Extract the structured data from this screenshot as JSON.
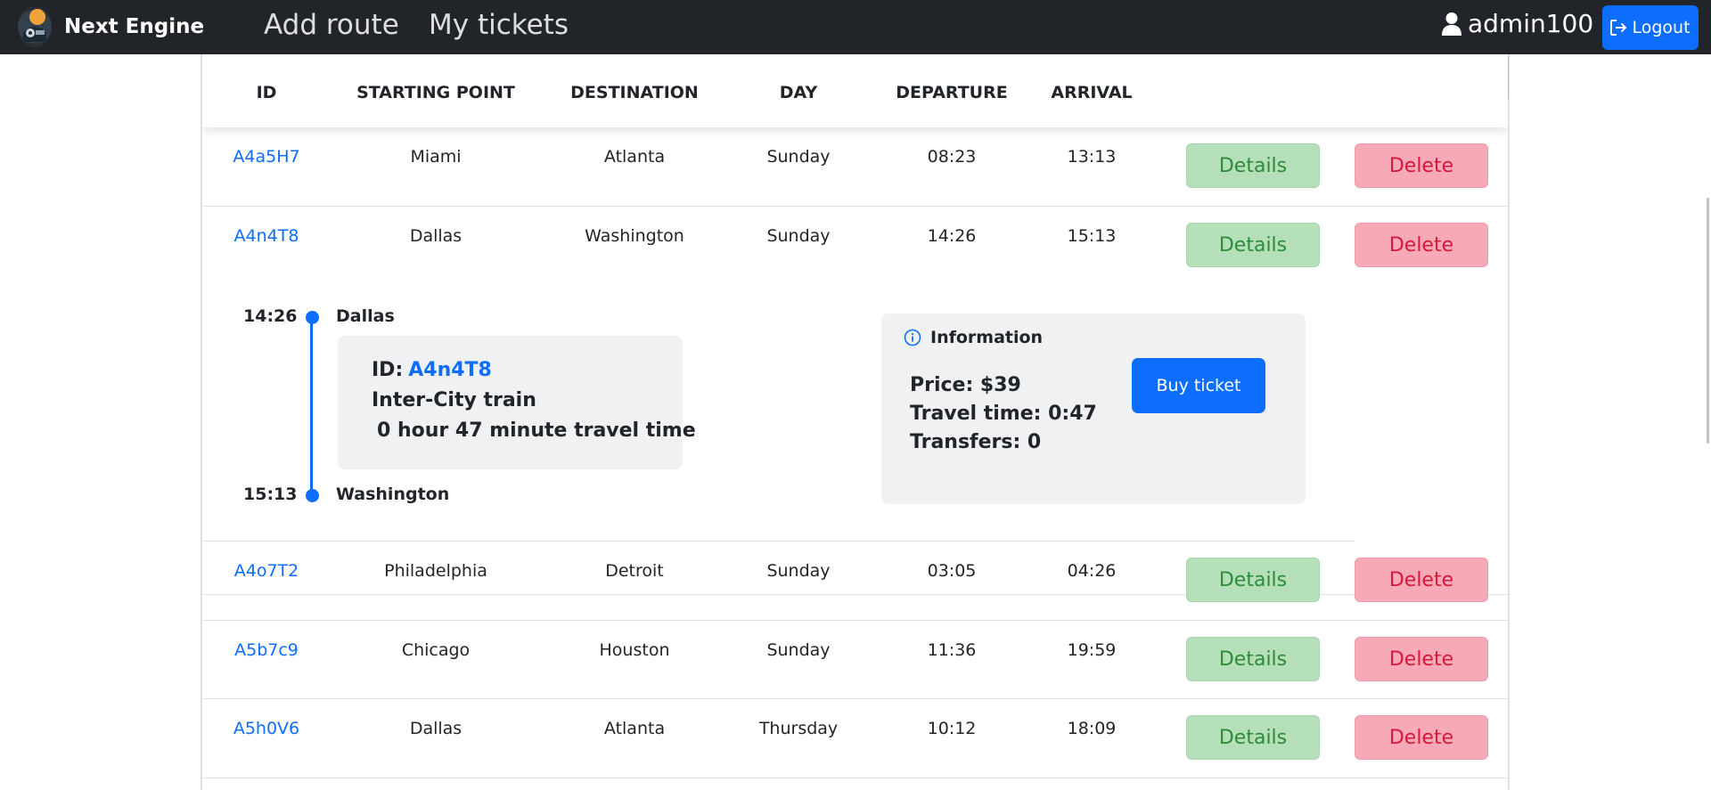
{
  "navbar": {
    "brand": "Next Engine",
    "links": [
      "Add route",
      "My tickets"
    ],
    "user": "admin100",
    "logout": "Logout"
  },
  "table": {
    "headers": [
      "ID",
      "STARTING POINT",
      "DESTINATION",
      "DAY",
      "DEPARTURE",
      "ARRIVAL"
    ],
    "rows": [
      {
        "id": "A4a5H7",
        "start": "Miami",
        "dest": "Atlanta",
        "day": "Sunday",
        "dep": "08:23",
        "arr": "13:13",
        "details": "Details",
        "delete": "Delete"
      },
      {
        "id": "A4n4T8",
        "start": "Dallas",
        "dest": "Washington",
        "day": "Sunday",
        "dep": "14:26",
        "arr": "15:13",
        "details": "Details",
        "delete": "Delete"
      },
      {
        "id": "A4o7T2",
        "start": "Philadelphia",
        "dest": "Detroit",
        "day": "Sunday",
        "dep": "03:05",
        "arr": "04:26",
        "details": "Details",
        "delete": "Delete"
      },
      {
        "id": "A5b7c9",
        "start": "Chicago",
        "dest": "Houston",
        "day": "Sunday",
        "dep": "11:36",
        "arr": "19:59",
        "details": "Details",
        "delete": "Delete"
      },
      {
        "id": "A5h0V6",
        "start": "Dallas",
        "dest": "Atlanta",
        "day": "Thursday",
        "dep": "10:12",
        "arr": "18:09",
        "details": "Details",
        "delete": "Delete"
      }
    ]
  },
  "expanded": {
    "dep_time": "14:26",
    "dep_city": "Dallas",
    "arr_time": "15:13",
    "arr_city": "Washington",
    "segment": {
      "id_label": "ID:",
      "id_value": "A4n4T8",
      "train_type": "Inter-City train",
      "travel": "0 hour 47 minute travel time"
    },
    "info": {
      "heading": "Information",
      "price": "Price: $39",
      "travel_time": "Travel time: 0:47",
      "transfers": "Transfers: 0",
      "buy": "Buy ticket"
    }
  },
  "colors": {
    "navbar_bg": "#212529",
    "primary": "#0d6efd",
    "details_bg": "#b5dfb8",
    "delete_bg": "#f8a9b8"
  }
}
